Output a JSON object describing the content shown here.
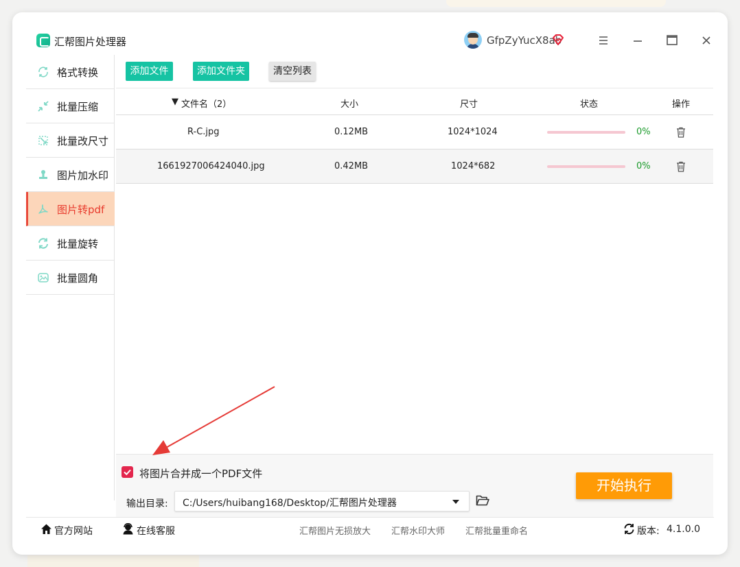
{
  "app": {
    "title": "汇帮图片处理器",
    "username": "GfpZyYucX8ab"
  },
  "sidebar": {
    "items": [
      {
        "label": "格式转换",
        "icon": "format-convert-icon"
      },
      {
        "label": "批量压缩",
        "icon": "compress-icon"
      },
      {
        "label": "批量改尺寸",
        "icon": "resize-icon"
      },
      {
        "label": "图片加水印",
        "icon": "watermark-icon"
      },
      {
        "label": "图片转pdf",
        "icon": "pdf-icon",
        "active": true
      },
      {
        "label": "批量旋转",
        "icon": "rotate-icon"
      },
      {
        "label": "批量圆角",
        "icon": "round-corner-icon"
      }
    ]
  },
  "toolbar": {
    "add_file": "添加文件",
    "add_folder": "添加文件夹",
    "clear_list": "清空列表"
  },
  "table": {
    "headers": {
      "filename": "文件名（2）",
      "size": "大小",
      "dimension": "尺寸",
      "status": "状态",
      "action": "操作"
    },
    "rows": [
      {
        "filename": "R-C.jpg",
        "size": "0.12MB",
        "dimension": "1024*1024",
        "progress": "0%"
      },
      {
        "filename": "1661927006424040.jpg",
        "size": "0.42MB",
        "dimension": "1024*682",
        "progress": "0%"
      }
    ]
  },
  "bottom": {
    "merge_label": "将图片合并成一个PDF文件",
    "merge_checked": true,
    "output_label": "输出目录:",
    "output_path": "C:/Users/huibang168/Desktop/汇帮图片处理器",
    "start_button": "开始执行"
  },
  "footer": {
    "website": "官方网站",
    "support": "在线客服",
    "links": [
      "汇帮图片无损放大",
      "汇帮水印大师",
      "汇帮批量重命名"
    ],
    "version_label": "版本:",
    "version": "4.1.0.0"
  },
  "colors": {
    "accent_green": "#16c3a3",
    "start_orange": "#ff9b06",
    "active_bg": "#fcd6ba",
    "active_text": "#e83a2c",
    "progress_green": "#1a9a2a"
  }
}
